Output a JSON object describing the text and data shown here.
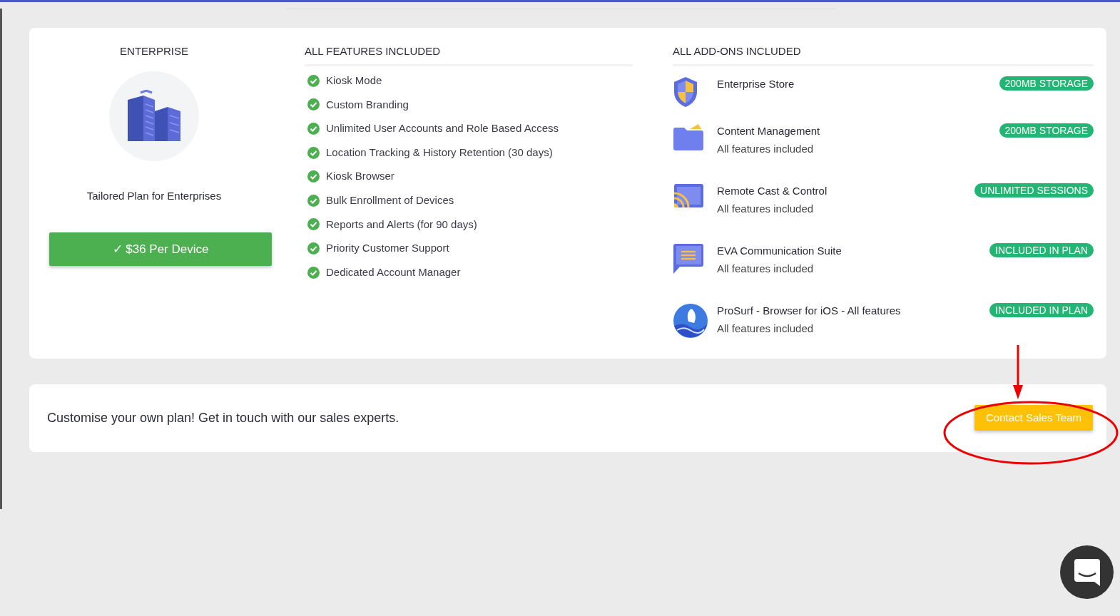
{
  "plan": {
    "name": "ENTERPRISE",
    "tagline": "Tailored Plan for Enterprises",
    "price_button": "✓ $36 Per Device"
  },
  "features": {
    "heading": "ALL FEATURES INCLUDED",
    "items": [
      "Kiosk Mode",
      "Custom Branding",
      "Unlimited User Accounts and Role Based Access",
      "Location Tracking & History Retention (30 days)",
      "Kiosk Browser",
      "Bulk Enrollment of Devices",
      "Reports and Alerts (for 90 days)",
      "Priority Customer Support",
      "Dedicated Account Manager"
    ]
  },
  "addons": {
    "heading": "ALL ADD-ONS INCLUDED",
    "items": [
      {
        "kind": "shield",
        "name": "Enterprise Store",
        "badge": "200MB STORAGE"
      },
      {
        "kind": "folder",
        "name": "Content Management",
        "detail": "All features included",
        "badge": "200MB STORAGE"
      },
      {
        "kind": "cast",
        "name": "Remote Cast & Control",
        "detail": "All features included",
        "badge": "UNLIMITED SESSIONS"
      },
      {
        "kind": "chat",
        "name": "EVA Communication Suite",
        "detail": "All features included",
        "badge": "INCLUDED IN PLAN"
      },
      {
        "kind": "globe",
        "name": "ProSurf - Browser for iOS - All features",
        "detail": "All features included",
        "badge": "INCLUDED IN PLAN"
      }
    ]
  },
  "custom_plan": {
    "text": "Customise your own plan! Get in touch with our sales experts.",
    "button": "Contact Sales Team"
  }
}
